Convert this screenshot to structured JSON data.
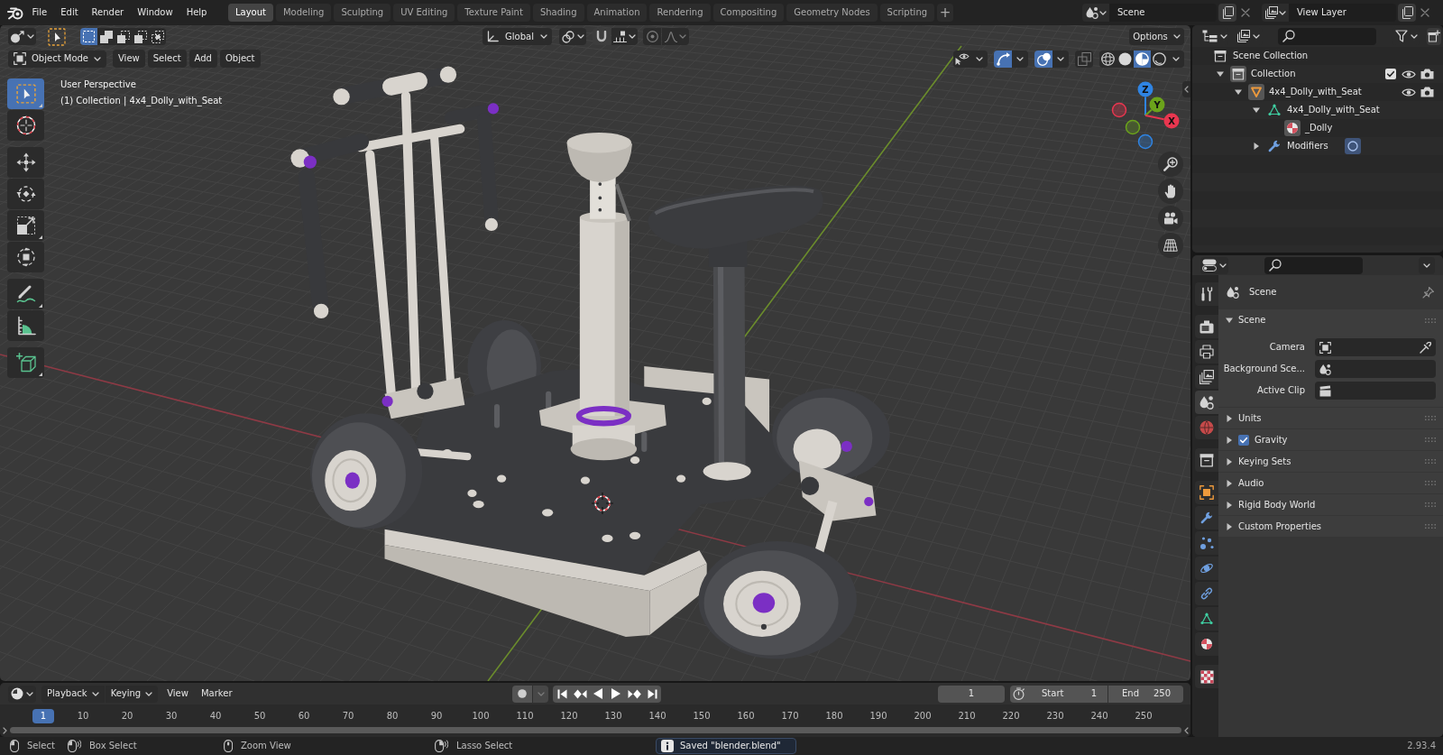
{
  "top_bar": {
    "menus": [
      "File",
      "Edit",
      "Render",
      "Window",
      "Help"
    ],
    "workspaces": [
      {
        "label": "Layout",
        "selected": true
      },
      {
        "label": "Modeling",
        "selected": false
      },
      {
        "label": "Sculpting",
        "selected": false
      },
      {
        "label": "UV Editing",
        "selected": false
      },
      {
        "label": "Texture Paint",
        "selected": false
      },
      {
        "label": "Shading",
        "selected": false
      },
      {
        "label": "Animation",
        "selected": false
      },
      {
        "label": "Rendering",
        "selected": false
      },
      {
        "label": "Compositing",
        "selected": false
      },
      {
        "label": "Geometry Nodes",
        "selected": false
      },
      {
        "label": "Scripting",
        "selected": false
      }
    ],
    "add_workspace": "+",
    "scene": "Scene",
    "view_layer": "View Layer"
  },
  "viewport": {
    "tool_header": {
      "select_modes": [
        {
          "kind": "set",
          "selected": true
        },
        {
          "kind": "extend",
          "selected": false
        },
        {
          "kind": "subtract",
          "selected": false
        },
        {
          "kind": "invert",
          "selected": false
        },
        {
          "kind": "intersect",
          "selected": false
        }
      ],
      "orientation": "Global",
      "options": "Options"
    },
    "header": {
      "mode": "Object Mode",
      "menus": [
        "View",
        "Select",
        "Add",
        "Object"
      ],
      "toggles": [
        {
          "kind": "selectability",
          "on": false
        },
        {
          "kind": "gizmos",
          "on": true
        },
        {
          "kind": "overlays",
          "on": true
        },
        {
          "kind": "xray",
          "on": false
        }
      ],
      "shading": [
        {
          "kind": "wireframe",
          "selected": false
        },
        {
          "kind": "solid",
          "selected": false
        },
        {
          "kind": "material",
          "selected": true
        },
        {
          "kind": "rendered",
          "selected": false
        }
      ]
    },
    "overlay_text": [
      "User Perspective",
      "(1) Collection | 4x4_Dolly_with_Seat"
    ],
    "tool_groups": [
      [
        {
          "kind": "select-box",
          "selected": true,
          "variants": true
        },
        {
          "kind": "cursor",
          "selected": false,
          "variants": false
        }
      ],
      [
        {
          "kind": "move",
          "selected": false,
          "variants": false
        },
        {
          "kind": "rotate",
          "selected": false,
          "variants": false
        },
        {
          "kind": "scale",
          "selected": false,
          "variants": true
        },
        {
          "kind": "transform",
          "selected": false,
          "variants": false
        }
      ],
      [
        {
          "kind": "annotate",
          "selected": false,
          "variants": true
        },
        {
          "kind": "measure",
          "selected": false,
          "variants": false
        }
      ],
      [
        {
          "kind": "add-cube",
          "selected": false,
          "variants": true
        }
      ]
    ],
    "gizmo_axes": [
      {
        "label": "Z",
        "color": "#2f84e3"
      },
      {
        "label": "Y",
        "color": "#6ba31b"
      },
      {
        "label": "X",
        "color": "#e8364f"
      }
    ]
  },
  "outliner": {
    "tree": [
      {
        "label": "Scene Collection",
        "kind": "scene-collection",
        "active": false,
        "children": [
          {
            "label": "Collection",
            "kind": "collection",
            "active": true,
            "expanded": true,
            "checked": true,
            "visible": true,
            "renderable": true,
            "children": [
              {
                "label": "4x4_Dolly_with_Seat",
                "kind": "object",
                "active": true,
                "expanded": true,
                "visible": true,
                "renderable": true,
                "children": [
                  {
                    "label": "4x4_Dolly_with_Seat",
                    "kind": "mesh",
                    "active": false,
                    "expanded": true,
                    "children": [
                      {
                        "label": "_Dolly",
                        "kind": "material",
                        "active": true
                      }
                    ]
                  },
                  {
                    "label": "Modifiers",
                    "kind": "modifiers",
                    "active": false,
                    "expanded": false
                  }
                ]
              }
            ]
          }
        ]
      }
    ]
  },
  "properties": {
    "tab_groups": [
      [
        {
          "kind": "tool",
          "selected": false
        }
      ],
      [
        {
          "kind": "render",
          "selected": false
        },
        {
          "kind": "output",
          "selected": false
        },
        {
          "kind": "view-layer",
          "selected": false
        },
        {
          "kind": "scene",
          "selected": true
        },
        {
          "kind": "world",
          "selected": false
        }
      ],
      [
        {
          "kind": "collection",
          "selected": false
        }
      ],
      [
        {
          "kind": "object",
          "selected": false
        },
        {
          "kind": "modifiers",
          "selected": false
        },
        {
          "kind": "particles",
          "selected": false
        },
        {
          "kind": "physics",
          "selected": false
        },
        {
          "kind": "constraints",
          "selected": false
        },
        {
          "kind": "data",
          "selected": false
        },
        {
          "kind": "material",
          "selected": false
        }
      ],
      [
        {
          "kind": "texture",
          "selected": false
        }
      ]
    ],
    "context": "Scene",
    "panels": [
      {
        "label": "Scene",
        "kind": "plain",
        "expanded": true,
        "fields": [
          {
            "label": "Camera",
            "kind": "object"
          },
          {
            "label": "Background Sce...",
            "kind": "scene"
          },
          {
            "label": "Active Clip",
            "kind": "clip"
          }
        ]
      },
      {
        "label": "Units",
        "kind": "plain",
        "expanded": false
      },
      {
        "label": "Gravity",
        "kind": "checkbox",
        "expanded": false,
        "checked": true
      },
      {
        "label": "Keying Sets",
        "kind": "plain",
        "expanded": false
      },
      {
        "label": "Audio",
        "kind": "plain",
        "expanded": false
      },
      {
        "label": "Rigid Body World",
        "kind": "plain",
        "expanded": false
      },
      {
        "label": "Custom Properties",
        "kind": "plain",
        "expanded": false
      }
    ]
  },
  "timeline": {
    "menus": [
      {
        "label": "Playback",
        "kind": "dropdown"
      },
      {
        "label": "Keying",
        "kind": "dropdown"
      },
      {
        "label": "View",
        "kind": "menu"
      },
      {
        "label": "Marker",
        "kind": "menu"
      }
    ],
    "transport": [
      {
        "kind": "jump-start"
      },
      {
        "kind": "prev-keyframe"
      },
      {
        "kind": "play-reverse"
      },
      {
        "kind": "play"
      },
      {
        "kind": "next-keyframe"
      },
      {
        "kind": "jump-end"
      }
    ],
    "current_frame": "1",
    "start_label": "Start",
    "start": "1",
    "end_label": "End",
    "end": "250",
    "playhead": "1",
    "ruler": [
      "10",
      "20",
      "30",
      "40",
      "50",
      "60",
      "70",
      "80",
      "90",
      "100",
      "110",
      "120",
      "130",
      "140",
      "150",
      "160",
      "170",
      "180",
      "190",
      "200",
      "210",
      "220",
      "230",
      "240",
      "250"
    ]
  },
  "status_bar": {
    "hints": [
      {
        "kind": "left-click",
        "label": "Select"
      },
      {
        "kind": "left-drag",
        "label": "Box Select"
      },
      {
        "kind": "middle-drag",
        "label": "Zoom View"
      },
      {
        "kind": "right-drag",
        "label": "Lasso Select"
      }
    ],
    "message": "Saved \"blender.blend\"",
    "version": "2.93.4"
  }
}
